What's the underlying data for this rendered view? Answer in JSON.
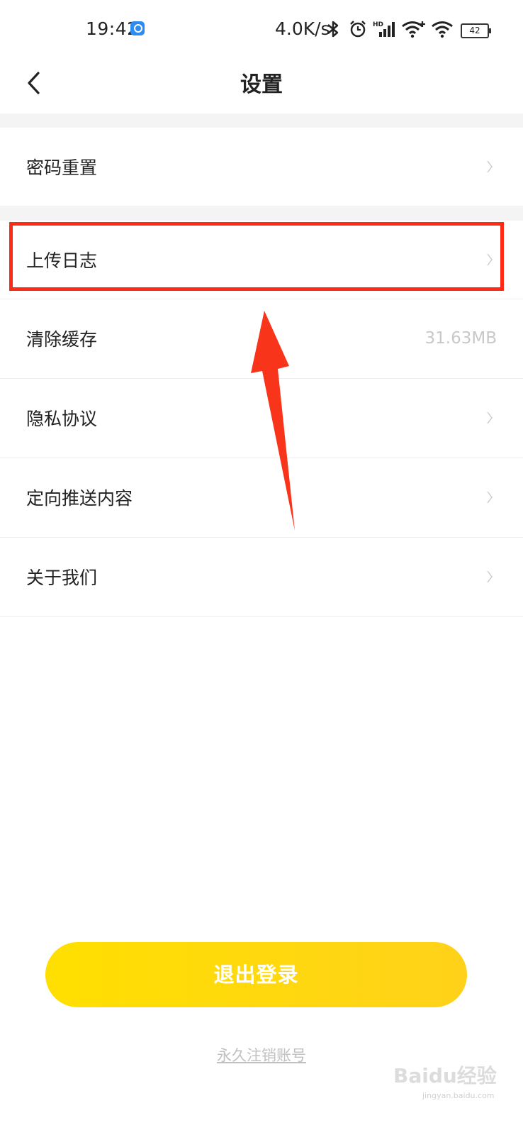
{
  "status_bar": {
    "time": "19:42",
    "net_speed": "4.0K/s",
    "battery": "42",
    "icons": [
      "app-notification-icon",
      "bluetooth-icon",
      "alarm-icon",
      "hd-signal-icon",
      "wifi-plus-icon",
      "wifi-icon",
      "battery-icon"
    ]
  },
  "header": {
    "title": "设置",
    "back_icon": "chevron-left-icon"
  },
  "settings": [
    {
      "label": "密码重置",
      "value": "",
      "accessory": "chevron-right-icon"
    },
    {
      "label": "上传日志",
      "value": "",
      "accessory": "chevron-right-icon"
    },
    {
      "label": "清除缓存",
      "value": "31.63MB",
      "accessory": ""
    },
    {
      "label": "隐私协议",
      "value": "",
      "accessory": "chevron-right-icon"
    },
    {
      "label": "定向推送内容",
      "value": "",
      "accessory": "chevron-right-icon"
    },
    {
      "label": "关于我们",
      "value": "",
      "accessory": "chevron-right-icon"
    }
  ],
  "actions": {
    "logout_label": "退出登录",
    "delete_account_label": "永久注销账号"
  },
  "watermark": {
    "brand": "Baidu经验",
    "url": "jingyan.baidu.com"
  },
  "colors": {
    "accent_yellow": "#ffd800",
    "highlight_red": "#ff2a14",
    "section_gap": "#f4f4f4"
  }
}
